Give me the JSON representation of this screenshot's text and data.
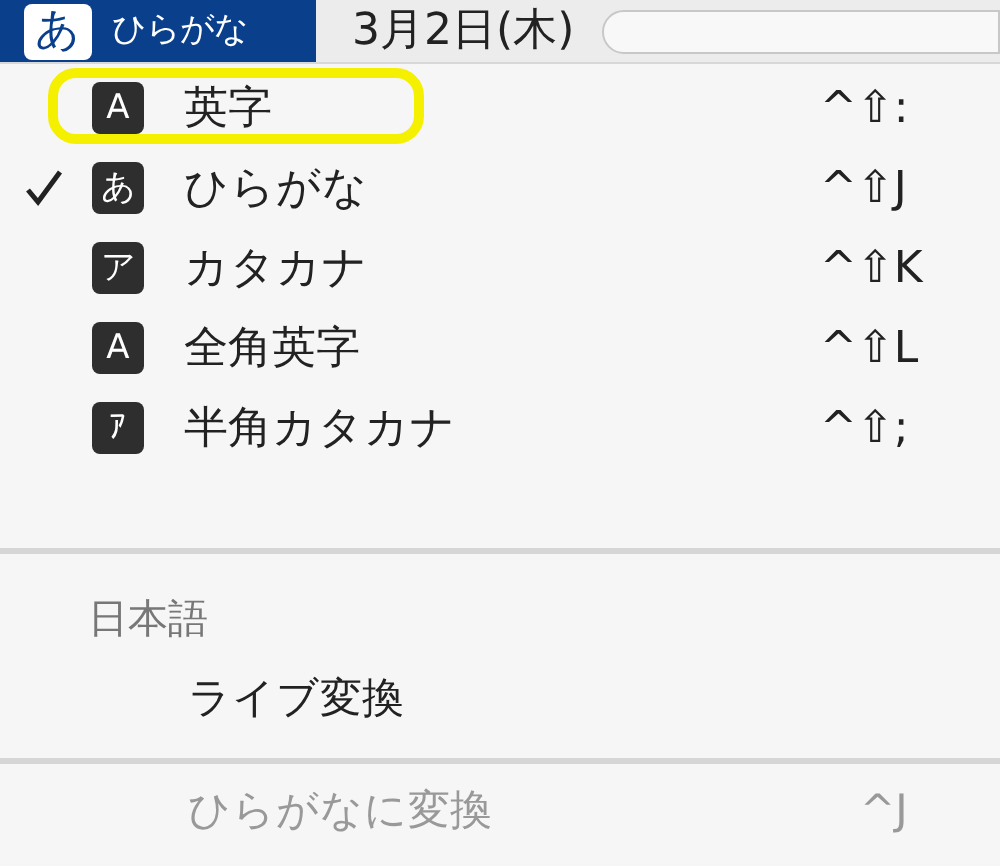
{
  "menu_bar": {
    "input_badge": "あ",
    "input_mode": "ひらがな",
    "date": "3月2日(木)"
  },
  "input_modes": [
    {
      "badge": "A",
      "label": "英字",
      "shortcut": "^⇧:",
      "selected": false,
      "highlighted": true
    },
    {
      "badge": "あ",
      "label": "ひらがな",
      "shortcut": "^⇧J",
      "selected": true,
      "highlighted": false
    },
    {
      "badge": "ア",
      "label": "カタカナ",
      "shortcut": "^⇧K",
      "selected": false,
      "highlighted": false
    },
    {
      "badge": "A",
      "label": "全角英字",
      "shortcut": "^⇧L",
      "selected": false,
      "highlighted": false
    },
    {
      "badge": "ｱ",
      "label": "半角カタカナ",
      "shortcut": "^⇧;",
      "selected": false,
      "highlighted": false
    }
  ],
  "section": {
    "title": "日本語",
    "items": [
      {
        "label": "ライブ変換",
        "disabled": false
      }
    ]
  },
  "actions": [
    {
      "label": "ひらがなに変換",
      "shortcut": "^J",
      "disabled": true
    }
  ]
}
